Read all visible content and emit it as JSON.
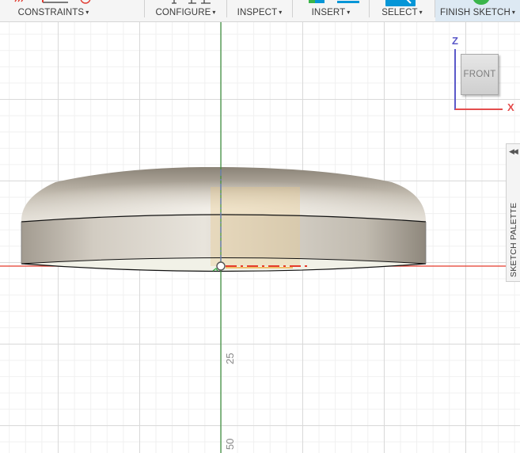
{
  "toolbar": {
    "groups": [
      {
        "label": "CONSTRAINTS",
        "caret": "▾"
      },
      {
        "label": "CONFIGURE",
        "caret": "▾"
      },
      {
        "label": "INSPECT",
        "caret": "▾"
      },
      {
        "label": "INSERT",
        "caret": "▾"
      },
      {
        "label": "SELECT",
        "caret": "▾"
      },
      {
        "label": "FINISH SKETCH",
        "caret": "▾"
      }
    ],
    "finish_icon_color": "#3ab54a",
    "select_icon_color": "#0696d7",
    "insert_icon_color": "#0696d7",
    "constraint_icon_color": "#e03a2f",
    "finish_highlight": "#dde9f3"
  },
  "viewport": {
    "ruler_labels": [
      "25",
      "50"
    ],
    "body_colors": {
      "highlight": "#f3efe6",
      "mid": "#c9c3b8",
      "dark": "#8f877b"
    },
    "axis_colors": {
      "x": "#e53b2c",
      "z": "#3a8e3a"
    }
  },
  "viewcube": {
    "face_label": "FRONT",
    "z_label": "Z",
    "x_label": "X",
    "z_color": "#5b59c9",
    "x_color": "#e44d4d"
  },
  "palette": {
    "label": "SKETCH PALETTE",
    "collapse_icon": "◀◀"
  }
}
